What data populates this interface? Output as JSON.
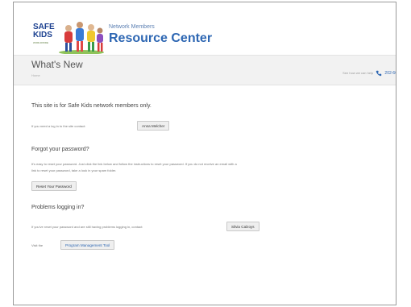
{
  "brand": {
    "logo_safe": "SAFE",
    "logo_kids": "KIDS",
    "logo_tagline": "WORLDWIDE",
    "subtitle": "Network Members",
    "title": "Resource Center"
  },
  "page": {
    "title": "What's New",
    "breadcrumb": "Home",
    "help_text": "See how we can help",
    "phone": "202-66"
  },
  "sections": {
    "intro_heading": "This site is for Safe Kids network members only.",
    "login_text": "If you need a log in to the site contact:",
    "login_contact_button": "Anna Melcher",
    "forgot_heading": "Forgot your password?",
    "forgot_text_1": "It's easy to reset your password. Just click the link below and follow the instructions to reset your password. If you do not receive an email with a",
    "forgot_text_2": "link to reset your password, take a look in your spam folder.",
    "reset_button": "Reset Your Password",
    "problems_heading": "Problems logging in?",
    "problems_text": "If you've reset your password and are still having problems logging in, contact:",
    "problems_contact_button": "Silvia Calzoys",
    "visit_text": "Visit the",
    "pmt_button": "Program Management Tool"
  },
  "colors": {
    "brand_blue": "#2e67b3",
    "band_gray": "#f2f2f2"
  }
}
